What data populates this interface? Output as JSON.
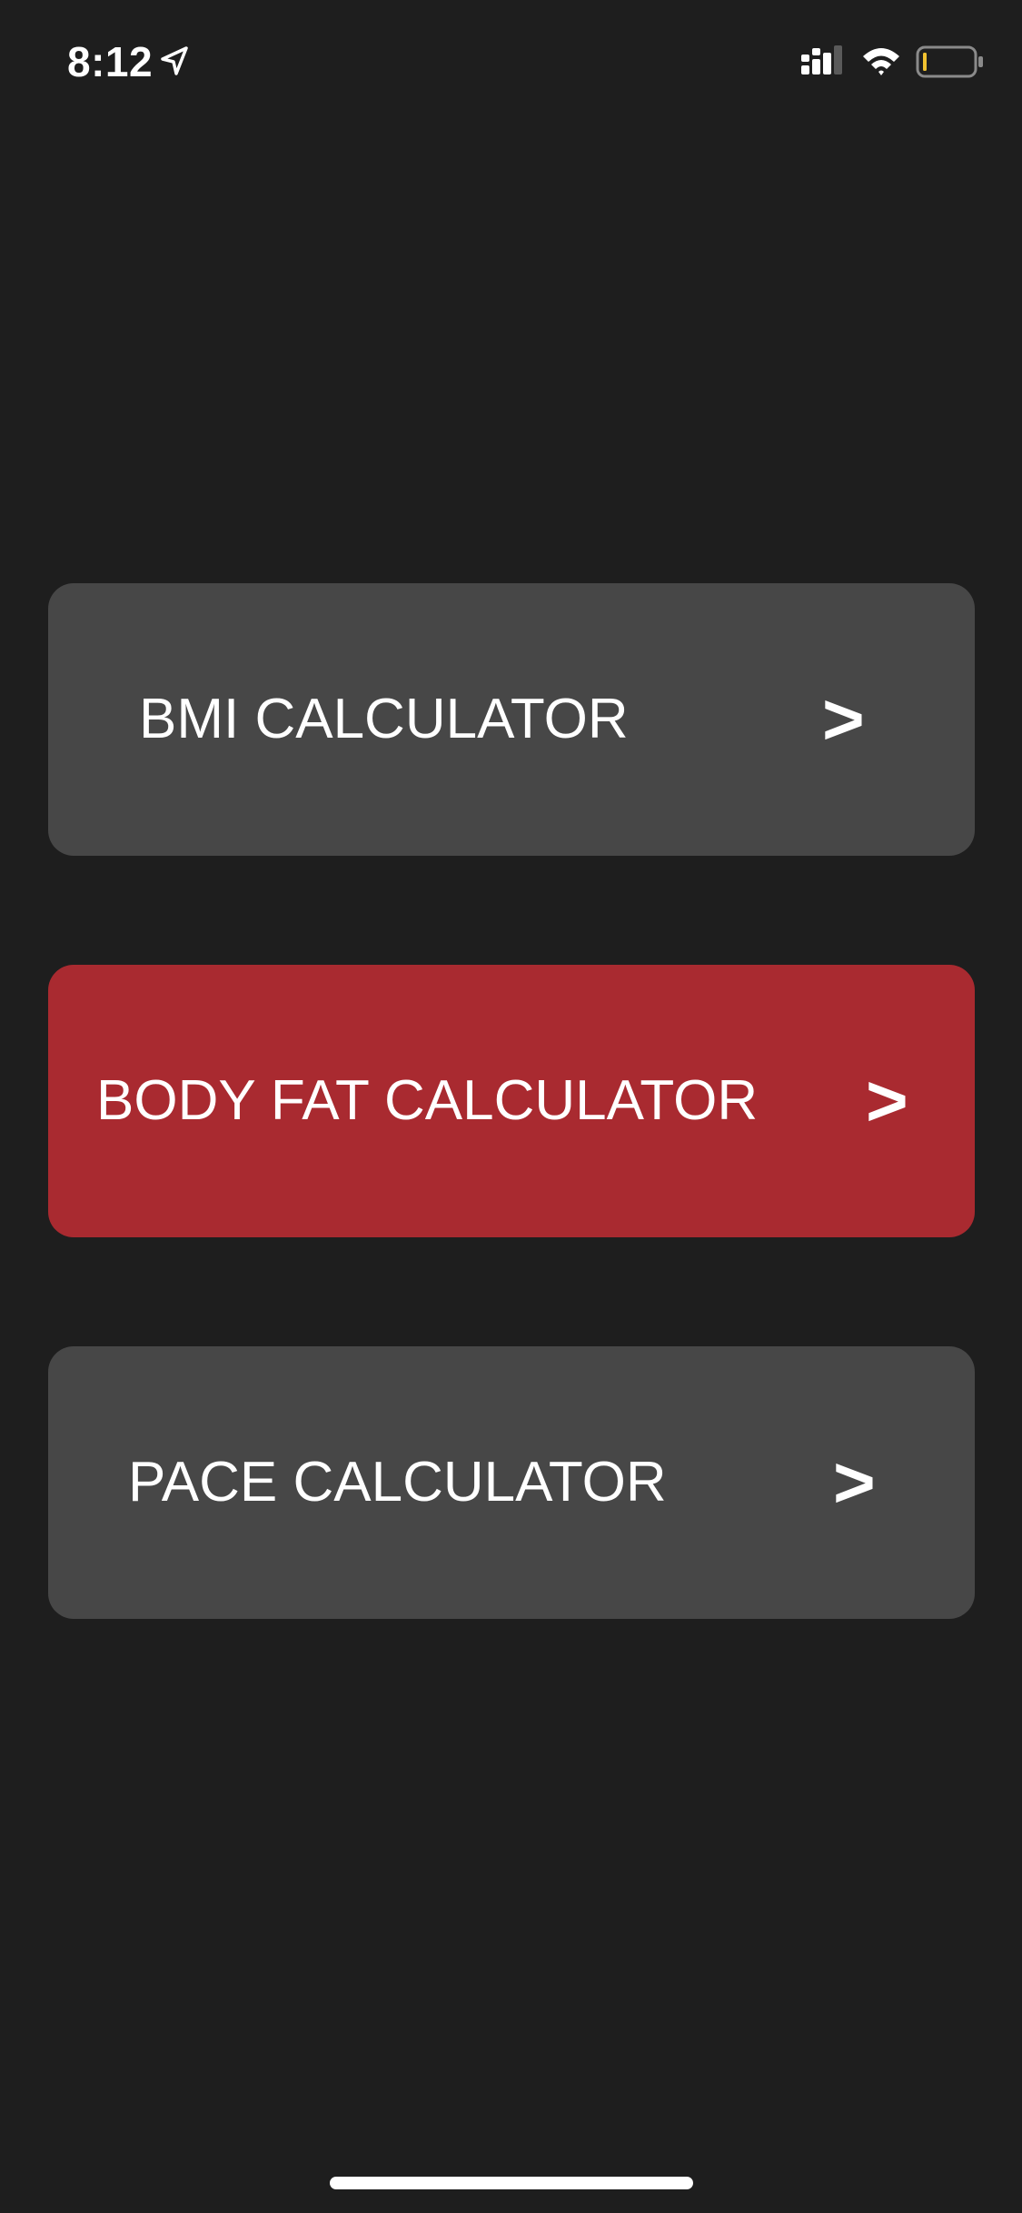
{
  "status_bar": {
    "time": "8:12",
    "icons": [
      "location-arrow-icon",
      "cellular-signal-icon",
      "wifi-icon",
      "battery-icon"
    ],
    "battery_color": "#f2c230"
  },
  "menu": {
    "items": [
      {
        "label": "BMI CALCULATOR",
        "chevron": ">",
        "selected": false
      },
      {
        "label": "BODY FAT CALCULATOR",
        "chevron": ">",
        "selected": true
      },
      {
        "label": "PACE CALCULATOR",
        "chevron": ">",
        "selected": false
      }
    ]
  },
  "colors": {
    "background": "#1e1e1e",
    "button": "#474747",
    "button_selected": "#a92a30",
    "text": "#ffffff"
  }
}
